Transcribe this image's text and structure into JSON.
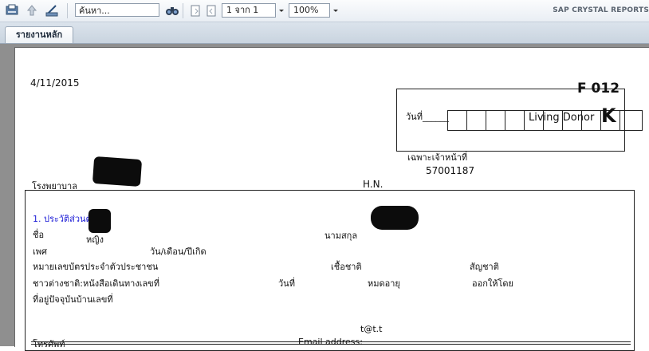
{
  "toolbar": {
    "search_placeholder": "ค้นหา...",
    "page_value": "1 จาก 1",
    "zoom_value": "100%",
    "brand": "SAP CRYSTAL REPORTS"
  },
  "tab": {
    "label": "รายงานหลัก"
  },
  "report": {
    "date": "4/11/2015",
    "form_code": "F 012",
    "date_label": "วันที่______",
    "donor_type": "Living Donor",
    "donor_code": "K",
    "staff_only": "เฉพาะเจ้าหน้าที่",
    "staff_number": "57001187",
    "hospital_label": "โรงพยาบาล",
    "hn_label": "H.N.",
    "section_title": "1. ประวัติส่วนตัว",
    "first_name_label": "ชื่อ",
    "sex_value": "หญิง",
    "last_name_label": "นามสกุล",
    "sex_label": "เพศ",
    "dob_label": "วัน/เดือน/ปีเกิด",
    "id_label": "หมายเลขบัตรประจำตัวประชาชน",
    "ethnicity_label": "เชื้อชาติ",
    "nationality_label": "สัญชาติ",
    "foreigner_label": "ชาวต่างชาติ:หนังสือเดินทางเลขที่",
    "date_short_label": "วันที่",
    "expiry_label": "หมดอายุ",
    "issued_by_label": "ออกให้โดย",
    "address_label": "ที่อยู่ปัจจุบันบ้านเลขที่",
    "email_value": "t@t.t",
    "phone_label": "โทรศัพท์",
    "email_label": "Email address:"
  }
}
